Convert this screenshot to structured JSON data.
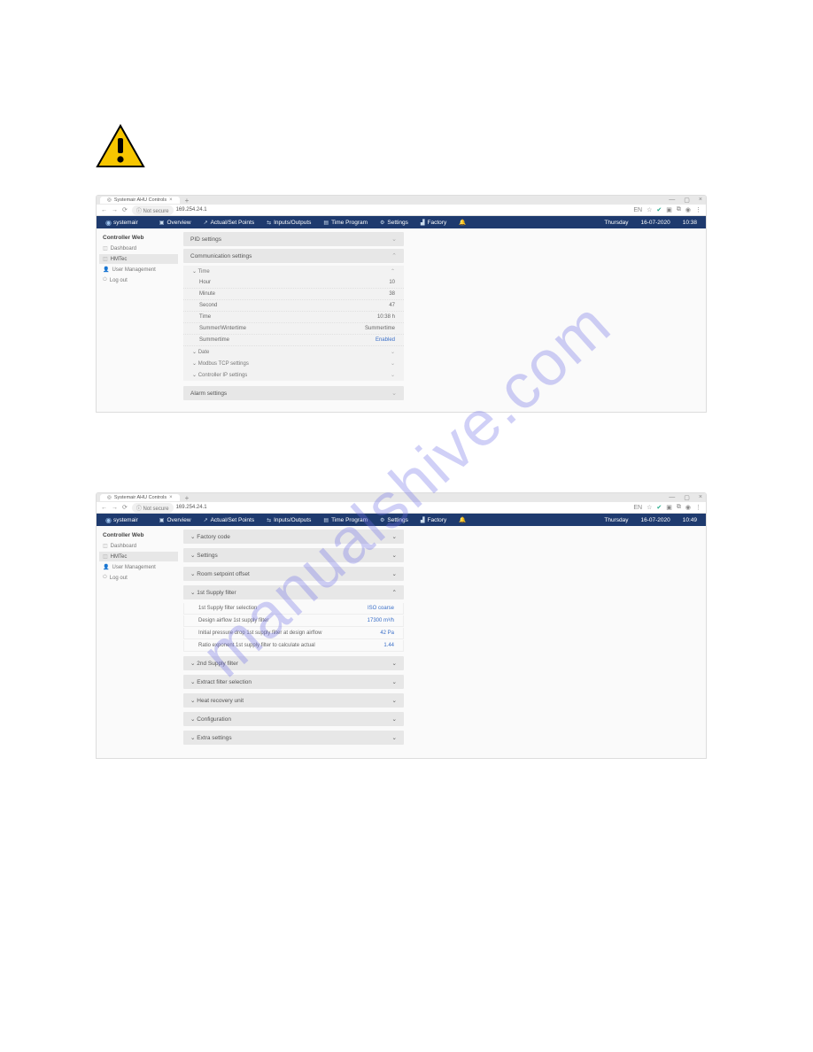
{
  "watermark": "manualshive.com",
  "browser1": {
    "tab_title": "Systemair AHU Controls",
    "url_not_secure": "Not secure",
    "url": "169.254.24.1",
    "lang_badge": "EN"
  },
  "browser2": {
    "tab_title": "Systemair AHU Controls",
    "url_not_secure": "Not secure",
    "url": "169.254.24.1",
    "lang_badge": "EN"
  },
  "nav1": {
    "brand": "systemair",
    "items": [
      "Overview",
      "Actual/Set Points",
      "Inputs/Outputs",
      "Time Program",
      "Settings",
      "Factory"
    ],
    "day": "Thursday",
    "date": "16-07-2020",
    "time": "10:38"
  },
  "nav2": {
    "brand": "systemair",
    "items": [
      "Overview",
      "Actual/Set Points",
      "Inputs/Outputs",
      "Time Program",
      "Settings",
      "Factory"
    ],
    "day": "Thursday",
    "date": "16-07-2020",
    "time": "10:49"
  },
  "sidebar": {
    "heading": "Controller Web",
    "items": [
      "Dashboard",
      "HMTec",
      "User Management",
      "Log out"
    ]
  },
  "settings_panels": {
    "pid": "PID settings",
    "comm": "Communication settings",
    "time_hdr": "Time",
    "time_rows": [
      {
        "label": "Hour",
        "value": "10"
      },
      {
        "label": "Minute",
        "value": "38"
      },
      {
        "label": "Second",
        "value": "47"
      }
    ],
    "time_combined_label": "Time",
    "time_combined_value": "10:38 h",
    "summer_label": "Summer/Wintertime",
    "summer_value": "Summertime",
    "summertime_label": "Summertime",
    "summertime_value": "Enabled",
    "date": "Date",
    "modbus": "Modbus TCP settings",
    "ctrl_ip": "Controller IP settings",
    "alarm": "Alarm settings"
  },
  "factory_panels": {
    "code": "Factory code",
    "settings": "Settings",
    "room_offset": "Room setpoint offset",
    "supply1_hdr": "1st Supply filter",
    "supply1_rows": [
      {
        "label": "1st Supply filter selection",
        "value": "ISO coarse"
      },
      {
        "label": "Design airflow 1st supply filter",
        "value": "17300 m³/h"
      },
      {
        "label": "Initial pressure drop 1st supply filter at design airflow",
        "value": "42 Pa"
      },
      {
        "label": "Ratio exponent 1st supply filter to calculate actual",
        "value": "1.44"
      }
    ],
    "supply2": "2nd Supply filter",
    "extract": "Extract filter selection",
    "hru": "Heat recovery unit",
    "config": "Configuration",
    "extra": "Extra settings"
  }
}
